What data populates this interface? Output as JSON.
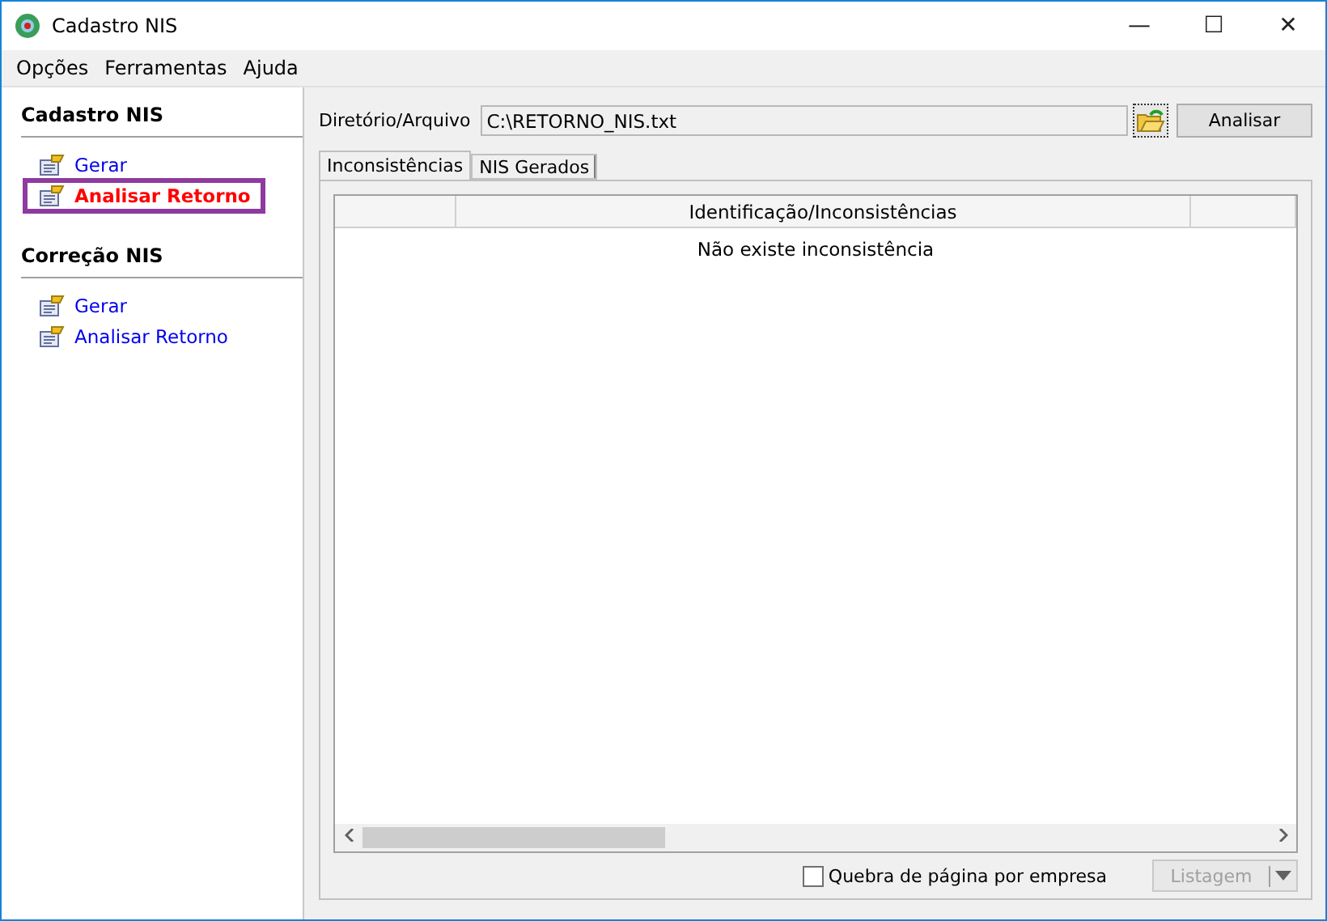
{
  "window": {
    "title": "Cadastro NIS",
    "controls": [
      "—",
      "☐",
      "✕"
    ]
  },
  "menu": [
    "Opções",
    "Ferramentas",
    "Ajuda"
  ],
  "sidebar": [
    {
      "title": "Cadastro NIS",
      "items": [
        {
          "label": "Gerar",
          "selected": false
        },
        {
          "label": "Analisar Retorno",
          "selected": true
        }
      ]
    },
    {
      "title": "Correção NIS",
      "items": [
        {
          "label": "Gerar",
          "selected": false
        },
        {
          "label": "Analisar Retorno",
          "selected": false
        }
      ]
    }
  ],
  "file": {
    "label": "Diretório/Arquivo",
    "value": "C:\\RETORNO_NIS.txt",
    "button": "Analisar"
  },
  "tabs": [
    {
      "label": "Inconsistências",
      "selected": true
    },
    {
      "label": "NIS Gerados",
      "selected": false
    }
  ],
  "table": {
    "columns": [
      "",
      "Identificação/Inconsistências",
      ""
    ],
    "empty_message": "Não existe inconsistência"
  },
  "footer": {
    "checkbox": {
      "label": "Quebra de página por empresa",
      "checked": false
    },
    "button": {
      "label": "Listagem",
      "disabled": true
    }
  }
}
